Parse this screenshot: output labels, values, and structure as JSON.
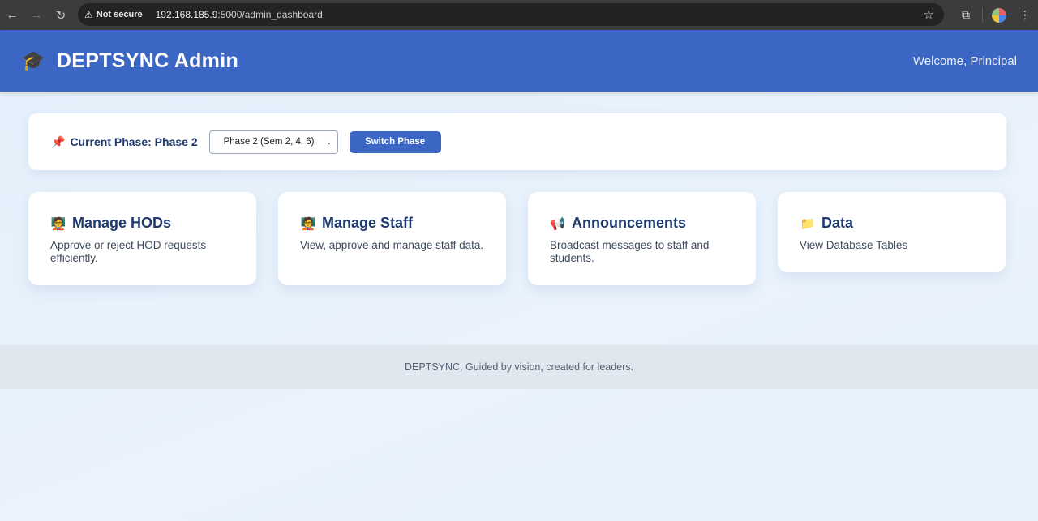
{
  "browser": {
    "not_secure": "Not secure",
    "url_host": "192.168.185.9",
    "url_rest": ":5000/admin_dashboard"
  },
  "header": {
    "brand_icon": "🎓",
    "title": "DEPTSYNC Admin",
    "welcome": "Welcome, Principal"
  },
  "phase": {
    "pin_icon": "📌",
    "label": "Current Phase: Phase 2",
    "selected_option": "Phase 2 (Sem 2, 4, 6)",
    "button_label": "Switch Phase"
  },
  "cards": [
    {
      "icon": "🧑‍🏫",
      "title": "Manage HODs",
      "desc": "Approve or reject HOD requests efficiently."
    },
    {
      "icon": "🧑‍🏫",
      "title": "Manage Staff",
      "desc": "View, approve and manage staff data."
    },
    {
      "icon": "📢",
      "title": "Announcements",
      "desc": "Broadcast messages to staff and students."
    },
    {
      "icon": "📁",
      "title": "Data",
      "desc": "View Database Tables"
    }
  ],
  "footer": {
    "text": "DEPTSYNC, Guided by vision, created for leaders."
  },
  "colors": {
    "accent": "#3b66c4",
    "heading": "#1f3a6e"
  }
}
